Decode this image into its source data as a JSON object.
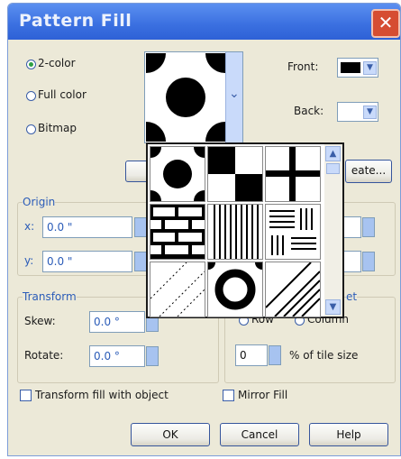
{
  "window": {
    "title": "Pattern Fill",
    "close_label": "✕"
  },
  "type": {
    "two_color": "2-color",
    "full_color": "Full color",
    "bitmap": "Bitmap",
    "selected": "2-color"
  },
  "colors": {
    "front_label": "Front:",
    "back_label": "Back:",
    "front_color": "#000000",
    "back_color": "#ffffff"
  },
  "create_button": "eate...",
  "origin": {
    "label": "Origin",
    "x_label": "x:",
    "x_value": "0.0 \"",
    "y_label": "y:",
    "y_value": "0.0 \""
  },
  "transform": {
    "label": "Transform",
    "skew_label": "Skew:",
    "skew_value": "0.0 °",
    "rotate_label": "Rotate:",
    "rotate_value": "0.0 °"
  },
  "row_offset": {
    "label": "et",
    "row": "Row",
    "column": "Column",
    "value": "0",
    "unit": "% of tile size"
  },
  "transform_fill": "Transform fill with object",
  "mirror_fill": "Mirror Fill",
  "buttons": {
    "ok": "OK",
    "cancel": "Cancel",
    "help": "Help"
  },
  "patterns": [
    "circles-pattern",
    "checker-pattern",
    "cross-pattern",
    "bricks-pattern",
    "vertical-lines-pattern",
    "lines-mix-pattern",
    "diagonal-sparse-pattern",
    "ring-pattern",
    "diagonal-dense-pattern"
  ],
  "icons": {
    "dropdown": "chevron-down-icon",
    "up": "scroll-up-icon",
    "down": "scroll-down-icon"
  }
}
